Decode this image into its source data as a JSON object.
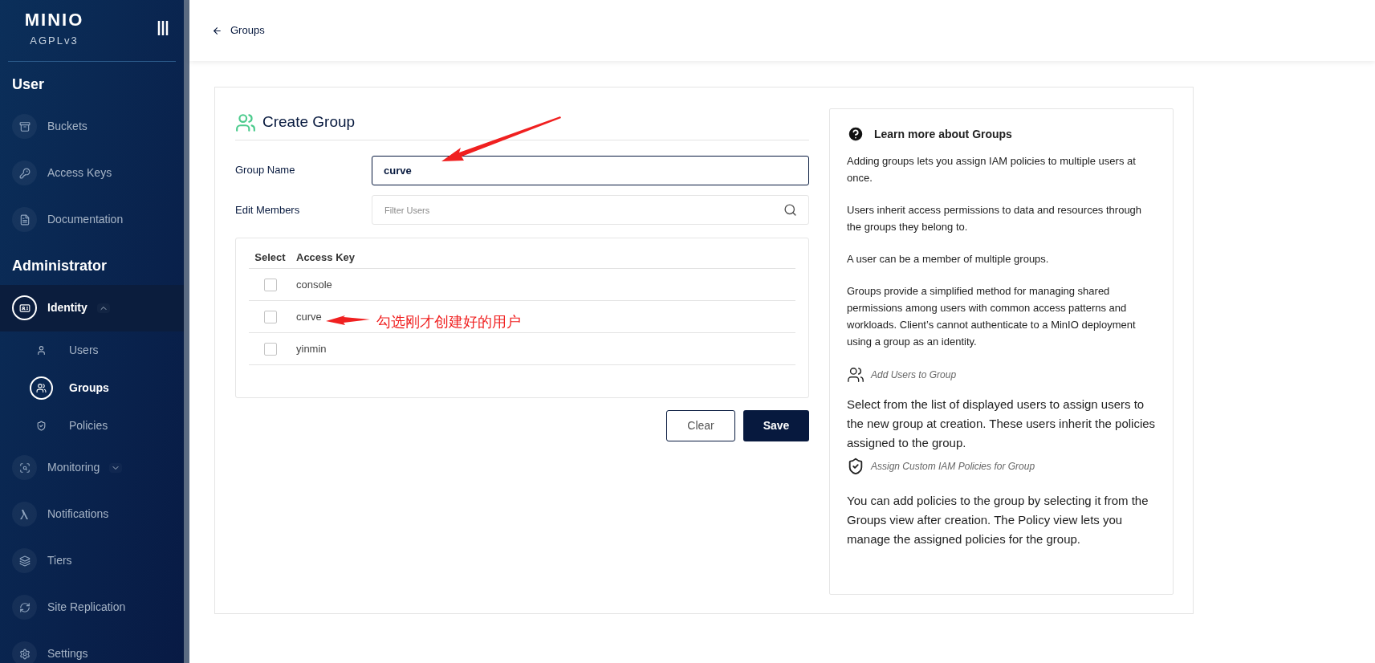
{
  "sidebar": {
    "logo": "MINIO",
    "license": "AGPLv3",
    "sections": [
      {
        "title": "User",
        "items": [
          {
            "label": "Buckets",
            "selected": false
          },
          {
            "label": "Access Keys",
            "selected": false
          },
          {
            "label": "Documentation",
            "selected": false
          }
        ]
      },
      {
        "title": "Administrator",
        "items": [
          {
            "label": "Identity",
            "selected": true,
            "expanded": true,
            "children": [
              {
                "label": "Users",
                "selected": false
              },
              {
                "label": "Groups",
                "selected": true
              },
              {
                "label": "Policies",
                "selected": false
              }
            ]
          },
          {
            "label": "Monitoring",
            "selected": false,
            "expanded": false
          },
          {
            "label": "Notifications",
            "selected": false
          },
          {
            "label": "Tiers",
            "selected": false
          },
          {
            "label": "Site Replication",
            "selected": false
          },
          {
            "label": "Settings",
            "selected": false
          }
        ]
      }
    ]
  },
  "header": {
    "back_link": "Groups"
  },
  "form": {
    "title": "Create Group",
    "group_name": {
      "label": "Group Name",
      "value": "curve"
    },
    "members": {
      "label": "Edit Members",
      "placeholder": "Filter Users"
    },
    "table": {
      "columns": [
        "Select",
        "Access Key"
      ],
      "rows": [
        {
          "access_key": "console",
          "checked": false
        },
        {
          "access_key": "curve",
          "checked": false
        },
        {
          "access_key": "yinmin",
          "checked": false
        }
      ]
    },
    "buttons": [
      {
        "label": "Clear",
        "kind": "secondary"
      },
      {
        "label": "Save",
        "kind": "primary"
      }
    ]
  },
  "annotation": {
    "text": "勾选刚才创建好的用户"
  },
  "help": {
    "title": "Learn more about Groups",
    "paragraphs": [
      "Adding groups lets you assign IAM policies to multiple users at once.",
      "Users inherit access permissions to data and resources through the groups they belong to.",
      "A user can be a member of multiple groups.",
      "Groups provide a simplified method for managing shared permissions among users with common access patterns and workloads. Client’s cannot authenticate to a MinIO deployment using a group as an identity."
    ],
    "sections": [
      {
        "heading": "Add Users to Group",
        "text": "Select from the list of displayed users to assign users to the new group at creation. These users inherit the policies assigned to the group."
      },
      {
        "heading": "Assign Custom IAM Policies for Group",
        "text": "You can add policies to the group by selecting it from the Groups view after creation. The Policy view lets you manage the assigned policies for the group."
      }
    ]
  }
}
